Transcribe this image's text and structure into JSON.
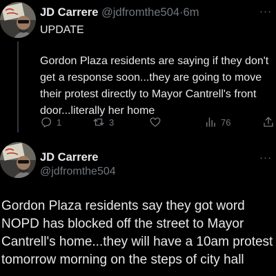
{
  "tweet1": {
    "author_name": "JD Carrere",
    "author_handle": "@jdfromthe504",
    "separator": "·",
    "time_ago": "6m",
    "lead": "UPDATE",
    "body": "Gordon Plaza residents are saying if they don't get a response soon...they are going to move their protest directly to Mayor Cantrell's front door...literally her home",
    "more_label": "···",
    "stats": {
      "replies": "1",
      "retweets": "3",
      "likes": "",
      "views": "76"
    },
    "icons": {
      "reply": "reply-icon",
      "retweet": "retweet-icon",
      "like": "heart-icon",
      "views": "views-icon",
      "share": "share-icon"
    }
  },
  "tweet2": {
    "author_name": "JD Carrere",
    "author_handle": "@jdfromthe504",
    "more_label": "···",
    "body": "Gordon Plaza residents say they got word NOPD has blocked off the street to Mayor Cantrell's home...they will have a 10am protest tomorrow morning on the steps of city hall"
  },
  "colors": {
    "background": "#000000",
    "text": "#e7e9ea",
    "muted": "#71767b",
    "thread_line": "#333639"
  }
}
